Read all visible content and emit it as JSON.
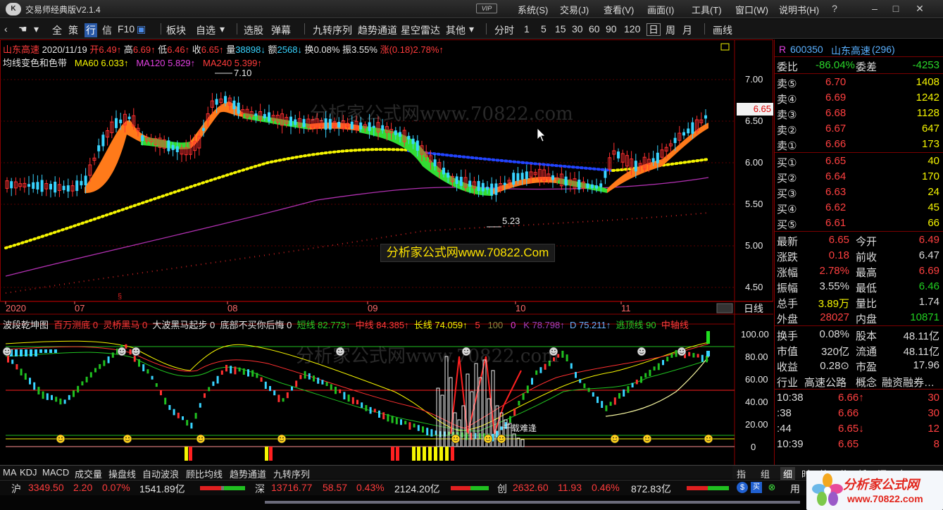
{
  "titlebar": {
    "logo": "K",
    "app_title": "交易师经典版V2.1.4",
    "vip": "VIP",
    "menus": [
      "系统(S)",
      "交易(J)",
      "查看(V)",
      "画面(I)",
      "工具(T)",
      "窗口(W)",
      "说明书(H)"
    ]
  },
  "toolbar": {
    "items": [
      "全",
      "策",
      "行",
      "信",
      "F10",
      "板块",
      "自选",
      "选股",
      "弹幕",
      "九转序列",
      "趋势通道",
      "星空雷达",
      "其他",
      "分时",
      "1",
      "5",
      "15",
      "30",
      "60",
      "90",
      "120",
      "日",
      "周",
      "月",
      "画线"
    ],
    "selected": "行",
    "active_period": "日"
  },
  "chart_header": {
    "name": "山东高速",
    "date": "2020/11/19",
    "open_label": "开",
    "open": "6.49↑",
    "high_label": "高",
    "high": "6.69↑",
    "low_label": "低",
    "low": "6.46↑",
    "close_label": "收",
    "close": "6.65↑",
    "vol_label": "量",
    "vol": "38898↓",
    "amt_label": "额",
    "amt": "2568↓",
    "turn_label": "换",
    "turn": "0.08%",
    "amp_label": "振",
    "amp": "3.55%",
    "chg_label": "涨",
    "chg": "(0.18)2.78%↑",
    "ma_title": "均线变色和色带",
    "ma60": "MA60 6.033↑",
    "ma120": "MA120 5.829↑",
    "ma240": "MA240 5.399↑"
  },
  "price_axis": [
    "7.00",
    "6.50",
    "6.00",
    "5.50",
    "5.00",
    "4.50"
  ],
  "current_price_tag": "6.65",
  "annotations": {
    "high": "7.10",
    "low": "5.23",
    "signal": "千载难逢"
  },
  "date_axis": [
    "2020",
    "07",
    "08",
    "09",
    "10",
    "11"
  ],
  "period_button": "日线",
  "indicator_header": {
    "title": "波段乾坤图",
    "f1": "百万测底 0",
    "f2": "灵桥黑马 0",
    "f3": "大波黑马起步 0",
    "f4": "底部不买你后悔 0",
    "f5": "短线 82.773↑",
    "f6": "中线 84.385↑",
    "f7": "长线 74.059↑",
    "f8": "5",
    "f9": "100",
    "f10": "0",
    "f11": "K 78.798↑",
    "f12": "D 75.211↑",
    "f13": "逃顶线 90",
    "f14": "中轴线"
  },
  "indicator_axis": [
    "100.00",
    "80.00",
    "60.00",
    "40.00",
    "20.00",
    "0"
  ],
  "watermark": {
    "big": "分析家公式网www.70822.com",
    "small": "分析家公式网www.70822.Com"
  },
  "quote": {
    "code": "600350",
    "name": "山东高速",
    "count": "(296)",
    "webi_label": "委比",
    "webi": "-86.04%",
    "wecha_label": "委差",
    "wecha": "-4253",
    "asks": [
      {
        "l": "卖⑤",
        "p": "6.70",
        "v": "1408"
      },
      {
        "l": "卖④",
        "p": "6.69",
        "v": "1242"
      },
      {
        "l": "卖③",
        "p": "6.68",
        "v": "1128"
      },
      {
        "l": "卖②",
        "p": "6.67",
        "v": "647"
      },
      {
        "l": "卖①",
        "p": "6.66",
        "v": "173"
      }
    ],
    "bids": [
      {
        "l": "买①",
        "p": "6.65",
        "v": "40"
      },
      {
        "l": "买②",
        "p": "6.64",
        "v": "170"
      },
      {
        "l": "买③",
        "p": "6.63",
        "v": "24"
      },
      {
        "l": "买④",
        "p": "6.62",
        "v": "45"
      },
      {
        "l": "买⑤",
        "p": "6.61",
        "v": "66"
      }
    ],
    "stats": [
      {
        "l1": "最新",
        "v1": "6.65",
        "l2": "今开",
        "v2": "6.49"
      },
      {
        "l1": "涨跌",
        "v1": "0.18",
        "l2": "前收",
        "v2": "6.47"
      },
      {
        "l1": "涨幅",
        "v1": "2.78%",
        "l2": "最高",
        "v2": "6.69"
      },
      {
        "l1": "振幅",
        "v1": "3.55%",
        "l2": "最低",
        "v2": "6.46"
      },
      {
        "l1": "总手",
        "v1": "3.89万",
        "l2": "量比",
        "v2": "1.74"
      },
      {
        "l1": "外盘",
        "v1": "28027",
        "l2": "内盘",
        "v2": "10871"
      }
    ],
    "fund": [
      {
        "l1": "换手",
        "v1": "0.08%",
        "l2": "股本",
        "v2": "48.11亿"
      },
      {
        "l1": "市值",
        "v1": "320亿",
        "l2": "流通",
        "v2": "48.11亿"
      },
      {
        "l1": "收益",
        "v1": "0.28⊙",
        "l2": "市盈",
        "v2": "17.96"
      }
    ],
    "industry_label": "行业",
    "industry": "高速公路",
    "concept_label": "概念",
    "concept": "融资融券…",
    "ticks": [
      {
        "t": "10:38",
        "p": "6.66↑",
        "v": "30"
      },
      {
        "t": ":38",
        "p": "6.66",
        "v": "30"
      },
      {
        "t": ":44",
        "p": "6.65↓",
        "v": "12"
      },
      {
        "t": "10:39",
        "p": "6.65",
        "v": "8"
      }
    ]
  },
  "bottom_tabs": [
    "MA",
    "KDJ",
    "MACD",
    "成交量",
    "操盘线",
    "自动波浪",
    "顾比均线",
    "趋势通道",
    "九转序列"
  ],
  "right_tabs": [
    "指",
    "组",
    "细",
    "时",
    "笔",
    "价",
    "析",
    "汇",
    "自"
  ],
  "status": {
    "sh_label": "沪",
    "sh": "3349.50",
    "sh_chg": "2.20",
    "sh_pct": "0.07%",
    "sh_amt": "1541.89亿",
    "sz_label": "深",
    "sz": "13716.77",
    "sz_chg": "58.57",
    "sz_pct": "0.43%",
    "sz_amt": "2124.20亿",
    "cy_label": "创",
    "cy": "2632.60",
    "cy_chg": "11.93",
    "cy_pct": "0.46%",
    "cy_amt": "872.83亿",
    "tail": "用"
  },
  "brand": {
    "t1": "分析家公式网",
    "t2": "www.70822.com"
  }
}
